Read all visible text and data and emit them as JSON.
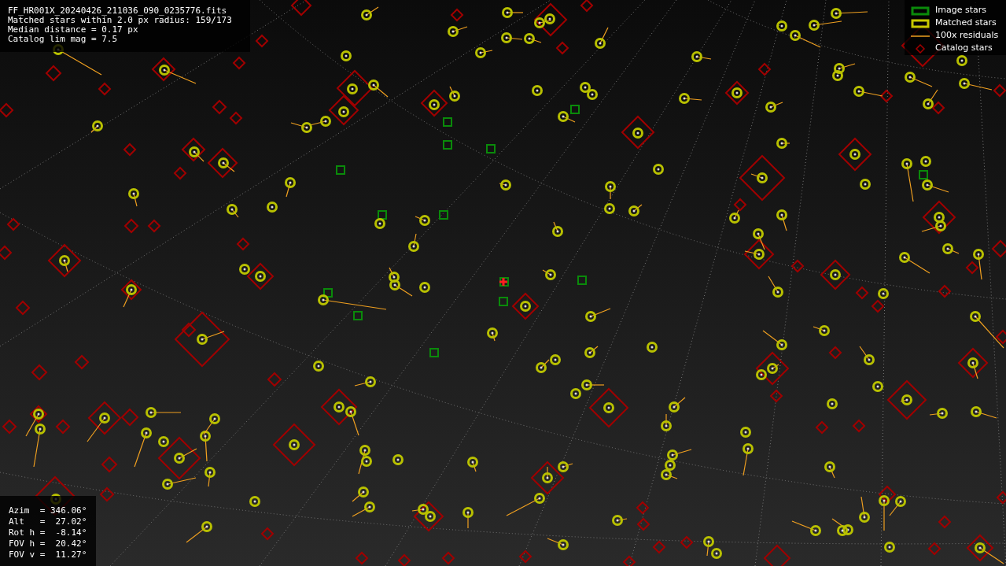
{
  "file_info": {
    "lines": [
      "FF_HR001X_20240426_211036_090_0235776.fits",
      "Matched stars within 2.0 px radius: 159/173",
      "Median distance = 0.17 px",
      "Catalog lim mag = 7.5"
    ]
  },
  "legend": {
    "items": [
      {
        "kind": "image",
        "label": "Image stars"
      },
      {
        "kind": "matched",
        "label": "Matched stars"
      },
      {
        "kind": "residual",
        "label": "100x residuals"
      },
      {
        "kind": "catalog",
        "label": "Catalog stars"
      }
    ]
  },
  "pointing": {
    "lines": [
      "Azim  = 346.06°",
      "Alt   =  27.02°",
      "Rot h =  -8.14°",
      "FOV h =  20.42°",
      "FOV v =  11.27°"
    ]
  }
}
